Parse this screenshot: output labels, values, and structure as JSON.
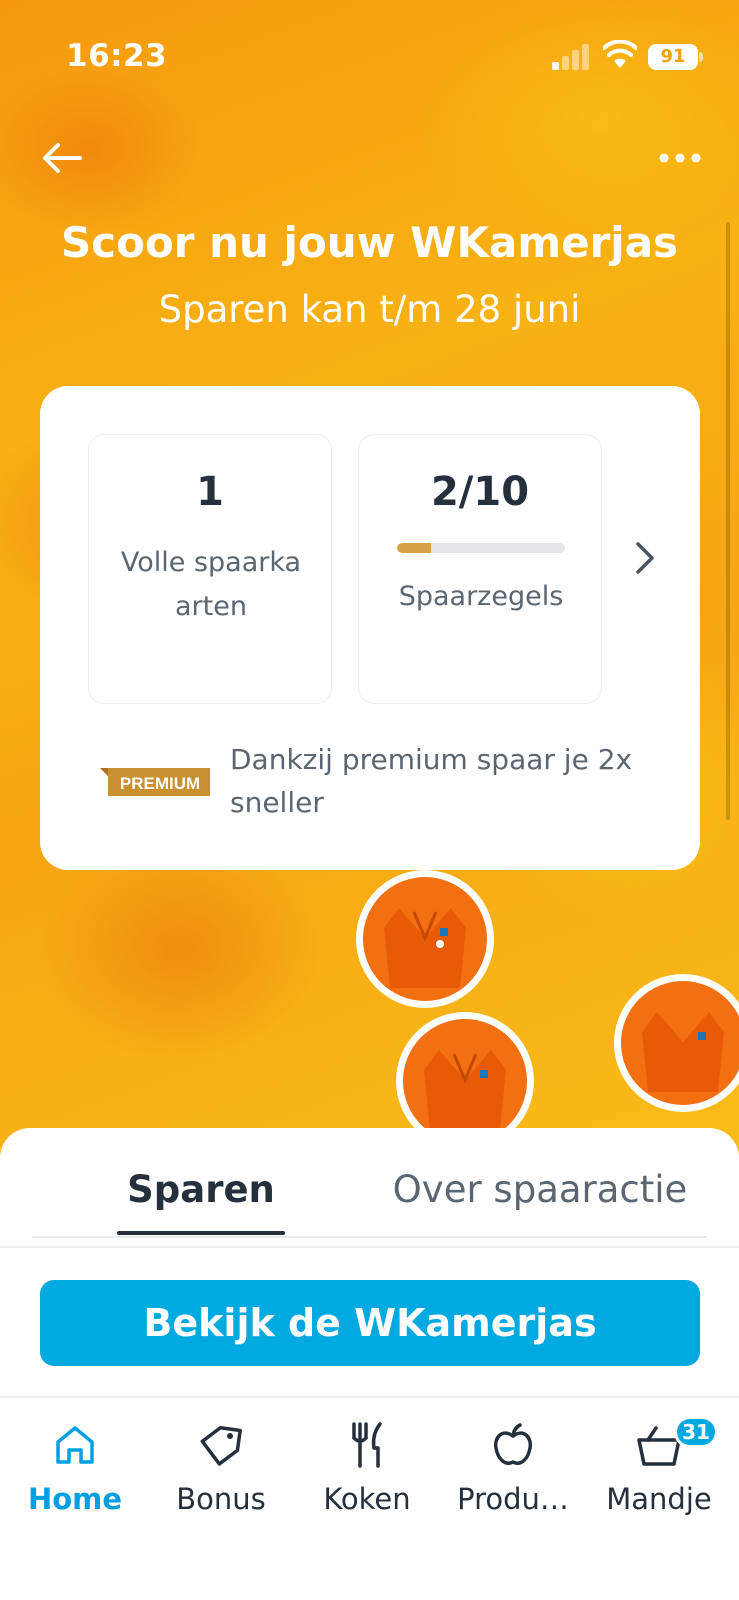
{
  "status_bar": {
    "time": "16:23",
    "battery_level": "91"
  },
  "header": {
    "back_icon": "arrow-left-icon",
    "more_icon": "more-horizontal-icon",
    "title": "Scoor nu jouw WKamerjas",
    "subtitle": "Sparen kan t/m 28 juni"
  },
  "savings_card": {
    "full_cards": {
      "value": "1",
      "label": "Volle spaarkaarten"
    },
    "stamps": {
      "value": "2/10",
      "label": "Spaarzegels",
      "progress_fraction": 0.2
    },
    "premium_badge": "PREMIUM",
    "premium_text": "Dankzij premium spaar je 2x sneller",
    "stamp_image_text": "WKamerjas-zegel"
  },
  "tabs": [
    {
      "label": "Sparen",
      "active": true
    },
    {
      "label": "Over spaaractie",
      "active": false
    }
  ],
  "cta": {
    "label": "Bekijk de WKamerjas"
  },
  "bottom_nav": [
    {
      "label": "Home",
      "icon": "home-icon",
      "active": true
    },
    {
      "label": "Bonus",
      "icon": "tag-icon",
      "active": false
    },
    {
      "label": "Koken",
      "icon": "cutlery-icon",
      "active": false
    },
    {
      "label": "Produ…",
      "icon": "apple-icon",
      "active": false
    },
    {
      "label": "Mandje",
      "icon": "basket-icon",
      "active": false,
      "badge": "31"
    }
  ],
  "colors": {
    "accent_blue": "#00a9e0",
    "hero_orange": "#f6a612",
    "premium_gold": "#c8902e",
    "text_dark": "#25303c"
  }
}
